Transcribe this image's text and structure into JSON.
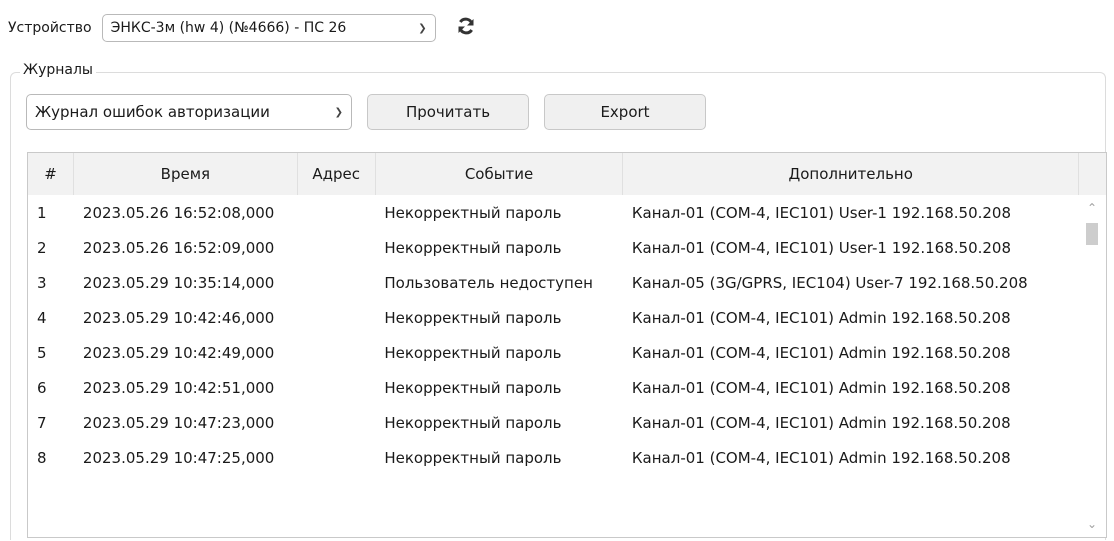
{
  "device": {
    "label": "Устройство",
    "selected": "ЭНКС-3м (hw 4) (№4666) - ПС 26"
  },
  "journals": {
    "legend": "Журналы",
    "selected": "Журнал ошибок авторизации",
    "read_label": "Прочитать",
    "export_label": "Export"
  },
  "table": {
    "columns": [
      "#",
      "Время",
      "Адрес",
      "Событие",
      "Дополнительно"
    ],
    "rows": [
      {
        "num": "1",
        "time": "2023.05.26 16:52:08,000",
        "addr": "",
        "event": "Некорректный пароль",
        "extra": "Канал-01 (COM-4, IEC101) User-1 192.168.50.208"
      },
      {
        "num": "2",
        "time": "2023.05.26 16:52:09,000",
        "addr": "",
        "event": "Некорректный пароль",
        "extra": "Канал-01 (COM-4, IEC101) User-1 192.168.50.208"
      },
      {
        "num": "3",
        "time": "2023.05.29 10:35:14,000",
        "addr": "",
        "event": "Пользователь недоступен",
        "extra": "Канал-05 (3G/GPRS, IEC104) User-7 192.168.50.208"
      },
      {
        "num": "4",
        "time": "2023.05.29 10:42:46,000",
        "addr": "",
        "event": "Некорректный пароль",
        "extra": "Канал-01 (COM-4, IEC101) Admin 192.168.50.208"
      },
      {
        "num": "5",
        "time": "2023.05.29 10:42:49,000",
        "addr": "",
        "event": "Некорректный пароль",
        "extra": "Канал-01 (COM-4, IEC101) Admin 192.168.50.208"
      },
      {
        "num": "6",
        "time": "2023.05.29 10:42:51,000",
        "addr": "",
        "event": "Некорректный пароль",
        "extra": "Канал-01 (COM-4, IEC101) Admin 192.168.50.208"
      },
      {
        "num": "7",
        "time": "2023.05.29 10:47:23,000",
        "addr": "",
        "event": "Некорректный пароль",
        "extra": "Канал-01 (COM-4, IEC101) Admin 192.168.50.208"
      },
      {
        "num": "8",
        "time": "2023.05.29 10:47:25,000",
        "addr": "",
        "event": "Некорректный пароль",
        "extra": "Канал-01 (COM-4, IEC101) Admin 192.168.50.208"
      }
    ]
  },
  "icons": {
    "refresh": "refresh-icon",
    "dropdown": "chevron-down-icon",
    "scroll_up": "chevron-up-icon",
    "scroll_down": "chevron-down-icon"
  }
}
